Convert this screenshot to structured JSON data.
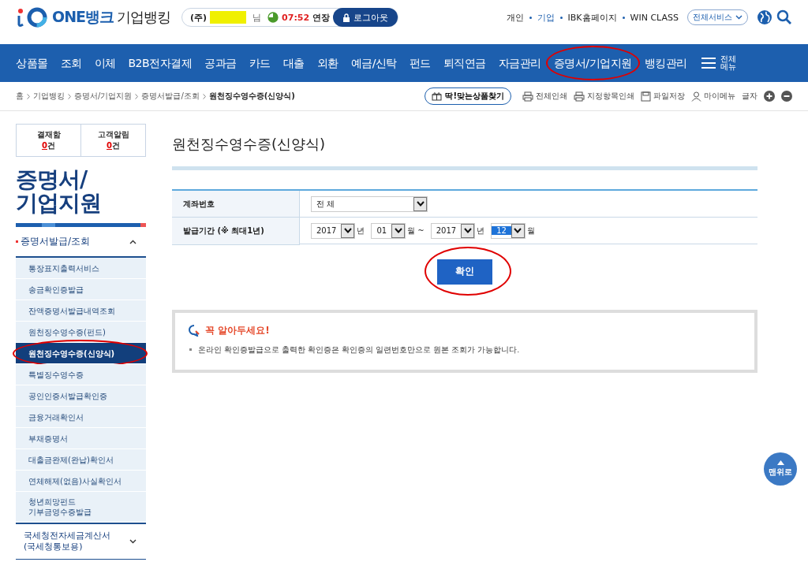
{
  "header": {
    "logo": "ONE뱅크",
    "logo_sub": "기업뱅킹",
    "company_prefix": "(주)",
    "honorific": "님",
    "timer": "07:52",
    "extend": "연장",
    "logout": "로그아웃",
    "links": [
      {
        "label": "개인",
        "selected": false
      },
      {
        "label": "기업",
        "selected": true
      },
      {
        "label": "IBK홈페이지",
        "selected": false
      },
      {
        "label": "WIN CLASS",
        "selected": false
      }
    ],
    "all_services": "전체서비스"
  },
  "nav": {
    "items": [
      {
        "label": "상품몰",
        "circled": false
      },
      {
        "label": "조회",
        "circled": false
      },
      {
        "label": "이체",
        "circled": false
      },
      {
        "label": "B2B전자결제",
        "circled": false
      },
      {
        "label": "공과금",
        "circled": false
      },
      {
        "label": "카드",
        "circled": false
      },
      {
        "label": "대출",
        "circled": false
      },
      {
        "label": "외환",
        "circled": false
      },
      {
        "label": "예금/신탁",
        "circled": false
      },
      {
        "label": "펀드",
        "circled": false
      },
      {
        "label": "퇴직연금",
        "circled": false
      },
      {
        "label": "자금관리",
        "circled": false
      },
      {
        "label": "증명서/기업지원",
        "circled": true
      },
      {
        "label": "뱅킹관리",
        "circled": false
      }
    ],
    "all_menu": "전체\n메뉴"
  },
  "breadcrumb": [
    "홈",
    "기업뱅킹",
    "증명서/기업지원",
    "증명서발급/조회",
    "원천징수영수증(신양식)"
  ],
  "tools": {
    "product_finder": "딱!맞는상품찾기",
    "items": [
      {
        "kind": "print",
        "label": "전체인쇄"
      },
      {
        "kind": "print",
        "label": "지정항목인쇄"
      },
      {
        "kind": "save",
        "label": "파일저장"
      },
      {
        "kind": "person",
        "label": "마이메뉴"
      }
    ],
    "font_size": "글자"
  },
  "sidebar": {
    "counters": [
      {
        "label": "결재함",
        "count": "0",
        "unit": "건"
      },
      {
        "label": "고객알림",
        "count": "0",
        "unit": "건"
      }
    ],
    "title": "증명서/\n기업지원",
    "section": {
      "label": "증명서발급/조회",
      "expanded": true
    },
    "items": [
      {
        "label": "통장표지출력서비스",
        "selected": false,
        "circled": false
      },
      {
        "label": "송금확인증발급",
        "selected": false,
        "circled": false
      },
      {
        "label": "잔액증명서발급내역조회",
        "selected": false,
        "circled": false
      },
      {
        "label": "원천징수영수증(펀드)",
        "selected": false,
        "circled": false
      },
      {
        "label": "원천징수영수증(신양식)",
        "selected": true,
        "circled": true
      },
      {
        "label": "특별징수영수증",
        "selected": false,
        "circled": false
      },
      {
        "label": "공인인증서발급확인증",
        "selected": false,
        "circled": false
      },
      {
        "label": "금융거래확인서",
        "selected": false,
        "circled": false
      },
      {
        "label": "부채증명서",
        "selected": false,
        "circled": false
      },
      {
        "label": "대출금완제(완납)확인서",
        "selected": false,
        "circled": false
      },
      {
        "label": "연체해제(없음)사실확인서",
        "selected": false,
        "circled": false
      },
      {
        "label": "청년희망펀드\n기부금영수증발급",
        "selected": false,
        "circled": false
      }
    ],
    "next_section": {
      "label": "국세청전자세금계산서\n(국세청통보용)",
      "expanded": false
    }
  },
  "page_title": "원천징수영수증(신양식)",
  "form": {
    "account_label": "계좌번호",
    "account_value": "전 체",
    "period_label": "발급기간 (※ 최대1년)",
    "period": [
      {
        "value": "2017",
        "unit": "년",
        "selected": false
      },
      {
        "value": "01",
        "unit": "월 ~",
        "selected": false
      },
      {
        "value": "2017",
        "unit": "년",
        "selected": false
      },
      {
        "value": "12",
        "unit": "월",
        "selected": true
      }
    ],
    "confirm": {
      "label": "확인",
      "circled": true
    }
  },
  "notice": {
    "title": "꼭 알아두세요!",
    "items": [
      "온라인 확인증발급으로 출력한 확인증은 확인증의 일련번호만으로 원본 조회가 가능합니다."
    ]
  },
  "top_button": "맨위로"
}
